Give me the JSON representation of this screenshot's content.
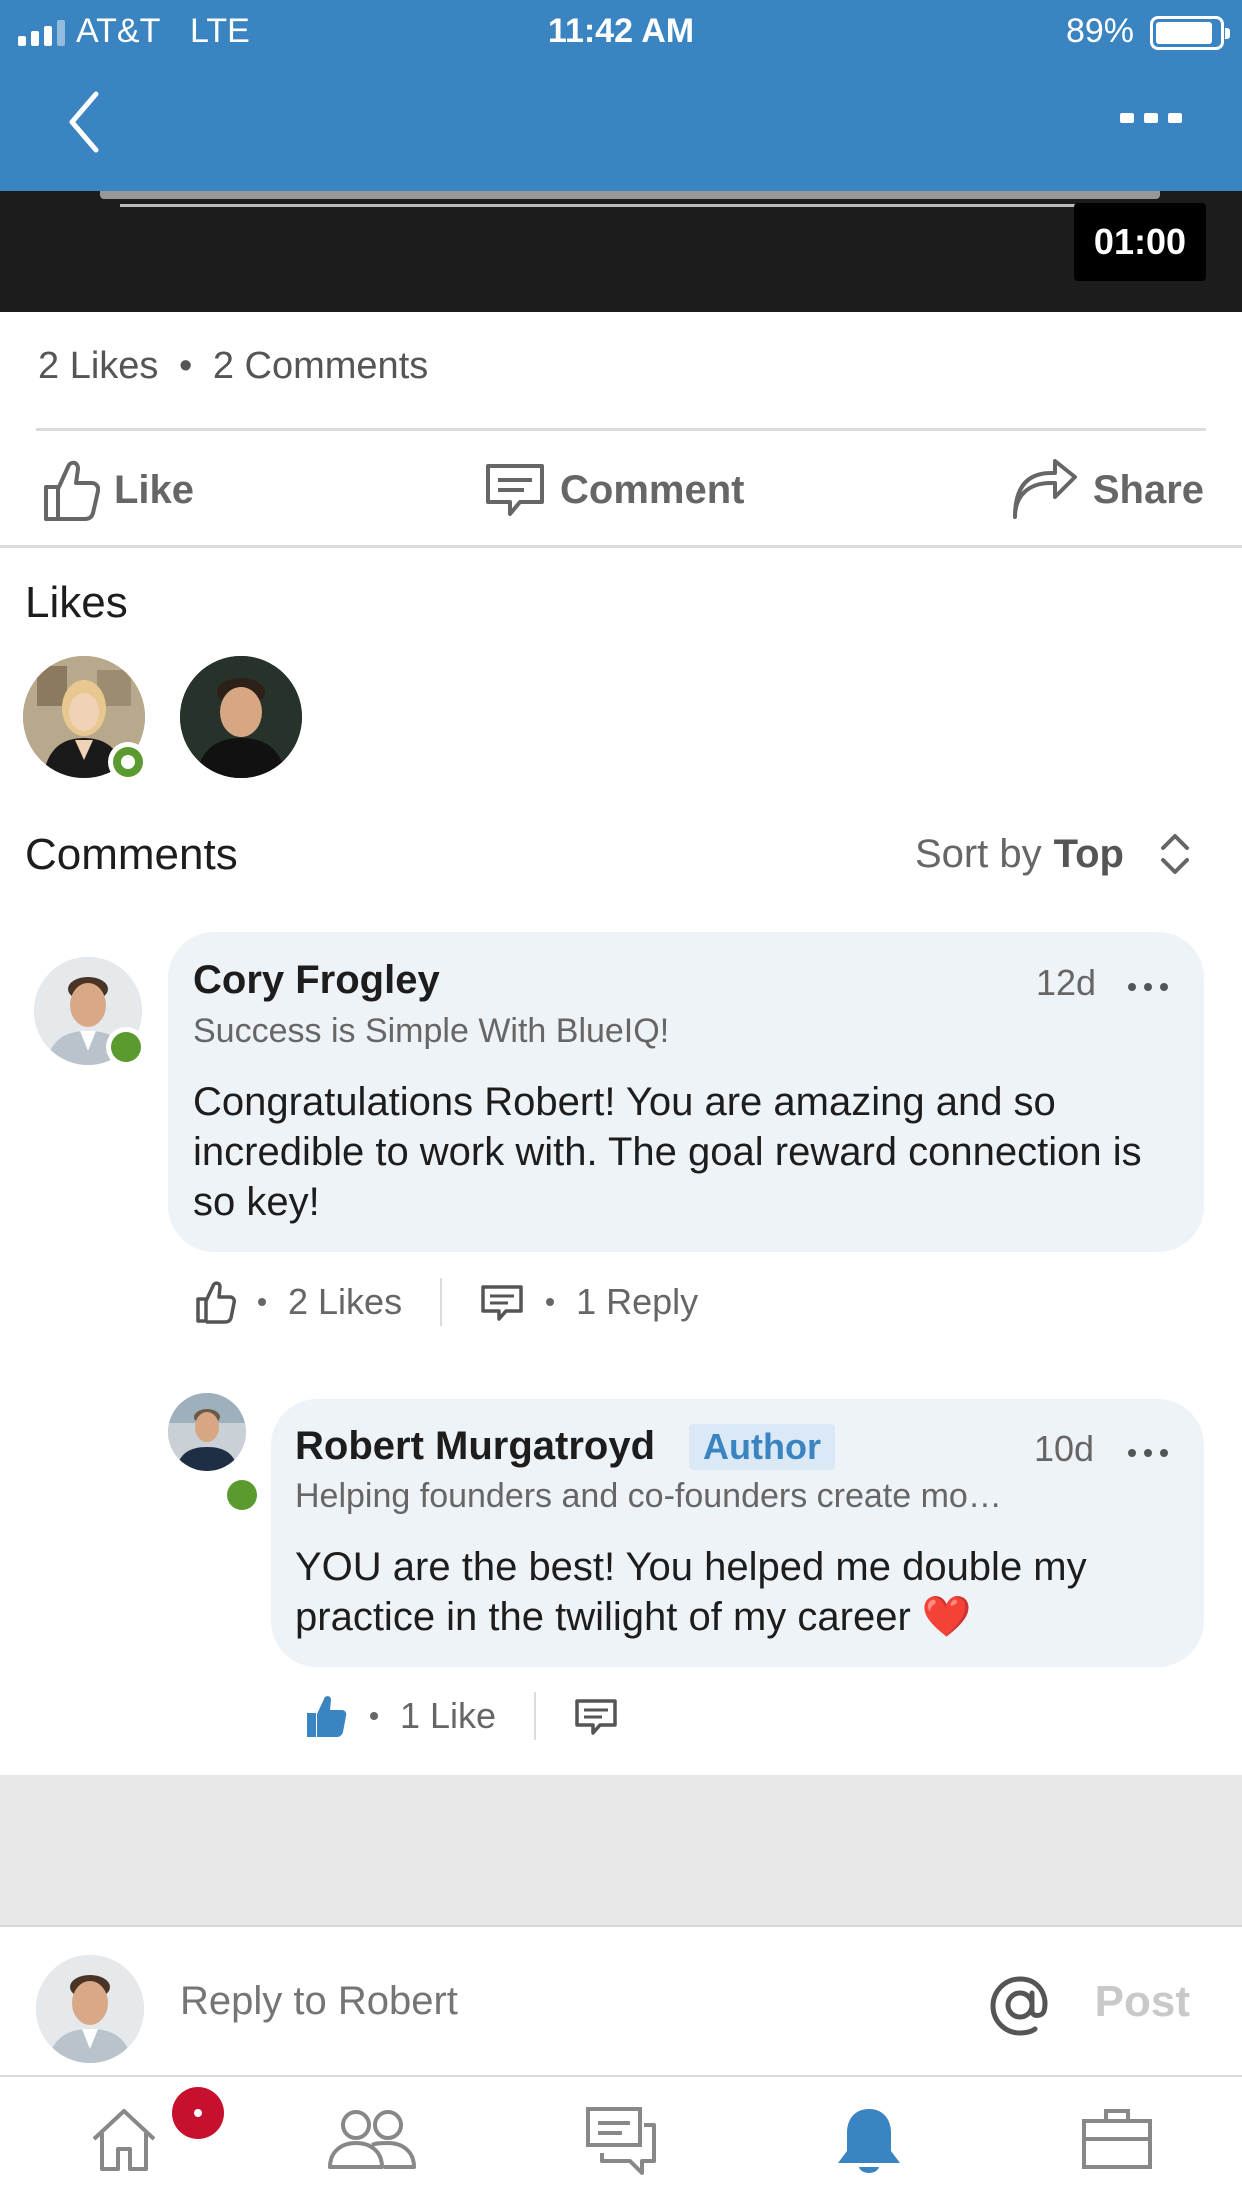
{
  "status_bar": {
    "carrier": "AT&T",
    "network": "LTE",
    "time": "11:42 AM",
    "battery": "89%"
  },
  "nav": {
    "back_icon": "chevron-left-icon",
    "more_icon": "more-horizontal-icon"
  },
  "video": {
    "duration": "01:00"
  },
  "post_stats": {
    "likes": "2 Likes",
    "comments": "2 Comments",
    "separator": "•"
  },
  "actions": {
    "like": "Like",
    "comment": "Comment",
    "share": "Share"
  },
  "likes_section": {
    "heading": "Likes"
  },
  "comments_section": {
    "heading": "Comments",
    "sort_prefix": "Sort by",
    "sort_value": "Top"
  },
  "comments": [
    {
      "name": "Cory Frogley",
      "headline": "Success is Simple With BlueIQ!",
      "time": "12d",
      "text": "Congratulations Robert! You are amazing and so incredible to work with. The goal reward connection is so key!",
      "likes": "2 Likes",
      "replies": "1 Reply",
      "online": true
    },
    {
      "name": "Robert Murgatroyd",
      "badge": "Author",
      "headline": "Helping founders and co-founders create mo…",
      "time": "10d",
      "text": "YOU are the best! You helped me double my practice in the twilight of my career ❤️",
      "likes": "1 Like",
      "online": true
    }
  ],
  "reply_bar": {
    "placeholder": "Reply to Robert",
    "post_label": "Post"
  },
  "tab_bar": {
    "tabs": [
      "home-icon",
      "my-network-icon",
      "messaging-icon",
      "notifications-icon",
      "jobs-icon"
    ],
    "active": "notifications-icon"
  },
  "colors": {
    "brand_blue": "#3a84c1",
    "online_green": "#5a9a2e",
    "badge_red": "#c7102e",
    "bubble_bg": "#eef3f8"
  }
}
